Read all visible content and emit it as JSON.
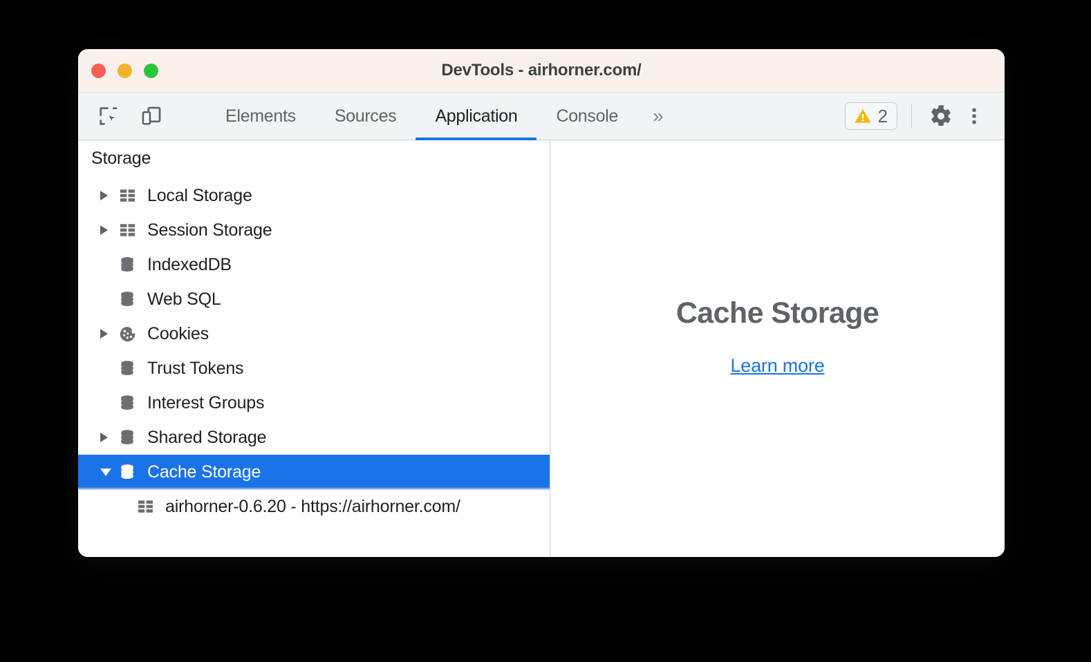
{
  "window": {
    "title": "DevTools - airhorner.com/",
    "traffic_lights": [
      {
        "name": "close",
        "color": "#fc5e55"
      },
      {
        "name": "minimize",
        "color": "#f2b32c"
      },
      {
        "name": "maximize",
        "color": "#29c53e"
      }
    ]
  },
  "toolbar": {
    "icons": [
      {
        "name": "inspect-element-icon",
        "label": "Inspect element"
      },
      {
        "name": "device-toolbar-icon",
        "label": "Toggle device toolbar"
      }
    ],
    "tabs": [
      {
        "label": "Elements",
        "active": false
      },
      {
        "label": "Sources",
        "active": false
      },
      {
        "label": "Application",
        "active": true
      },
      {
        "label": "Console",
        "active": false
      }
    ],
    "more_tabs_label": "»",
    "warnings": {
      "icon": "warning-triangle-icon",
      "count": "2",
      "color": "#f5b400"
    },
    "settings_label": "Settings",
    "menu_label": "Customize and control DevTools",
    "accent_color": "#1a73e8"
  },
  "sidebar": {
    "section_title": "Storage",
    "items": [
      {
        "label": "Local Storage",
        "icon": "table-icon",
        "twisty": "collapsed",
        "depth": 0,
        "selected": false
      },
      {
        "label": "Session Storage",
        "icon": "table-icon",
        "twisty": "collapsed",
        "depth": 0,
        "selected": false
      },
      {
        "label": "IndexedDB",
        "icon": "database-icon",
        "twisty": "none",
        "depth": 0,
        "selected": false
      },
      {
        "label": "Web SQL",
        "icon": "database-icon",
        "twisty": "none",
        "depth": 0,
        "selected": false
      },
      {
        "label": "Cookies",
        "icon": "cookie-icon",
        "twisty": "collapsed",
        "depth": 0,
        "selected": false
      },
      {
        "label": "Trust Tokens",
        "icon": "database-icon",
        "twisty": "none",
        "depth": 0,
        "selected": false
      },
      {
        "label": "Interest Groups",
        "icon": "database-icon",
        "twisty": "none",
        "depth": 0,
        "selected": false
      },
      {
        "label": "Shared Storage",
        "icon": "database-icon",
        "twisty": "collapsed",
        "depth": 0,
        "selected": false
      },
      {
        "label": "Cache Storage",
        "icon": "database-icon",
        "twisty": "expanded",
        "depth": 0,
        "selected": true
      },
      {
        "label": "airhorner-0.6.20 - https://airhorner.com/",
        "icon": "table-icon",
        "twisty": "none",
        "depth": 1,
        "selected": false
      }
    ],
    "selection_color": "#1b73e8"
  },
  "main": {
    "empty_title": "Cache Storage",
    "learn_more_label": "Learn more",
    "link_color": "#1a73e8"
  }
}
